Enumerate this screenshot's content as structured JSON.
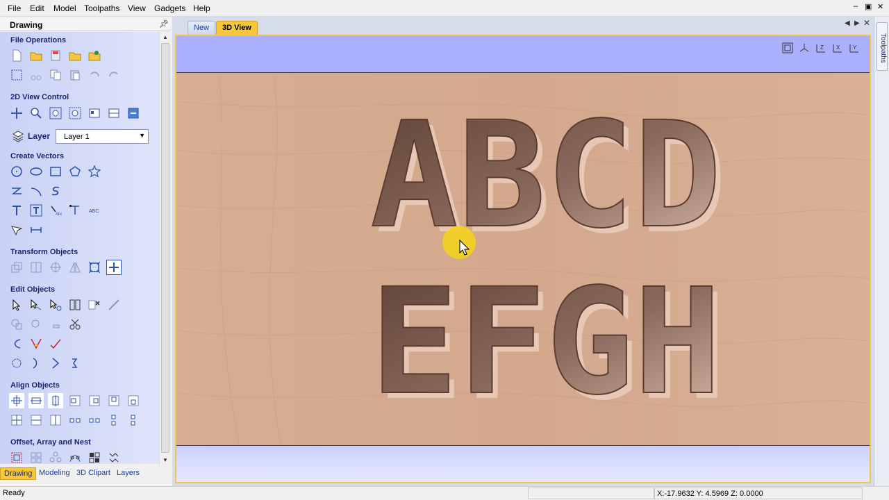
{
  "menu": [
    "File",
    "Edit",
    "Model",
    "Toolpaths",
    "View",
    "Gadgets",
    "Help"
  ],
  "window_controls": [
    "–",
    "▣",
    "✕"
  ],
  "panel": {
    "title": "Drawing",
    "sections": {
      "file_operations": "File Operations",
      "view_control": "2D View Control",
      "create_vectors": "Create Vectors",
      "transform_objects": "Transform Objects",
      "edit_objects": "Edit Objects",
      "align_objects": "Align Objects",
      "offset_array_nest": "Offset, Array and Nest"
    },
    "layer_label": "Layer",
    "layer_value": "Layer 1",
    "bottom_tabs": [
      "Drawing",
      "Modeling",
      "3D Clipart",
      "Layers"
    ]
  },
  "doc_tabs": [
    "New",
    "3D View"
  ],
  "right_tab": "Toolpaths",
  "view_tools": [
    "zoom-extents",
    "iso-view",
    "top-view-z",
    "x-view",
    "y-view"
  ],
  "carved_text": {
    "line1": "ABCD",
    "line2": "EFGH"
  },
  "status": {
    "message": "Ready",
    "coords": "X:-17.9632 Y:  4.5969 Z:  0.0000"
  },
  "colors": {
    "accent": "#f5c73a",
    "panel": "#c9d2f6",
    "wood": "#d8ad90",
    "carve": "#6b4a3c"
  }
}
